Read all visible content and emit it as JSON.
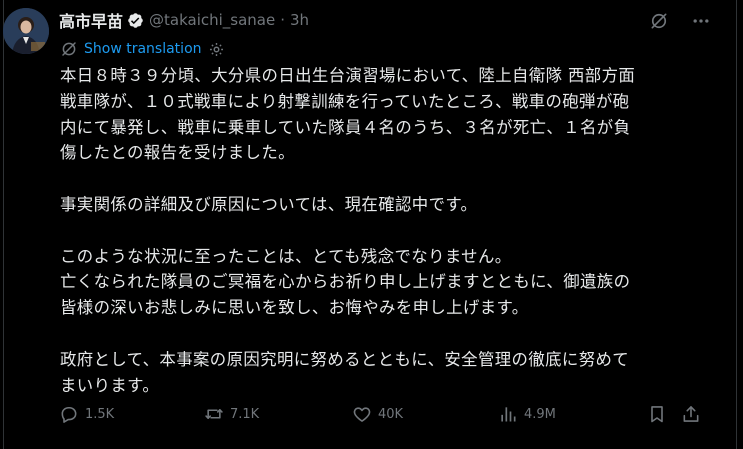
{
  "author": {
    "name": "高市早苗",
    "handle": "@takaichi_sanae",
    "separator": "·",
    "time": "3h"
  },
  "translate": {
    "label": "Show translation"
  },
  "post": {
    "text": "本日８時３９分頃、大分県の日出生台演習場において、陸上自衛隊 西部方面\n戦車隊が、１０式戦車により射撃訓練を行っていたところ、戦車の砲弾が砲\n内にて暴発し、戦車に乗車していた隊員４名のうち、３名が死亡、１名が負\n傷したとの報告を受けました。\n\n事実関係の詳細及び原因については、現在確認中です。\n\nこのような状況に至ったことは、とても残念でなりません。\n亡くなられた隊員のご冥福を心からお祈り申し上げますとともに、御遺族の\n皆様の深いお悲しみに思いを致し、お悔やみを申し上げます。\n\n政府として、本事案の原因究明に努めるとともに、安全管理の徹底に努めて\nまいります。"
  },
  "actions": {
    "replies": "1.5K",
    "reposts": "7.1K",
    "likes": "40K",
    "views": "4.9M"
  },
  "colors": {
    "background": "#000000",
    "text": "#e7e9ea",
    "muted": "#71767b",
    "accent": "#1d9bf0",
    "border": "#2f3336"
  },
  "icons": [
    "verified-badge-icon",
    "grok-icon",
    "more-icon",
    "translate-icon",
    "settings-icon",
    "reply-icon",
    "repost-icon",
    "like-icon",
    "views-icon",
    "bookmark-icon",
    "share-icon"
  ]
}
